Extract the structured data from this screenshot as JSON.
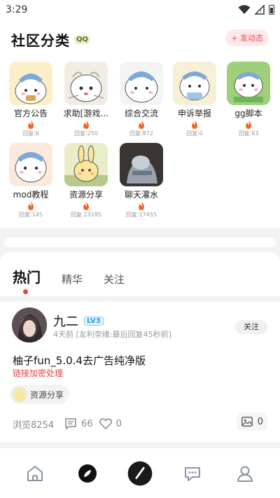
{
  "status_bar": {
    "time": "3:29"
  },
  "categories_section": {
    "title": "社区分类",
    "title_badge": "QQ",
    "post_button": "+ 发动态",
    "items": [
      {
        "name": "官方公告",
        "replies": "回复:6"
      },
      {
        "name": "求助[游戏…",
        "replies": "回复:250"
      },
      {
        "name": "综合交流",
        "replies": "回复:872"
      },
      {
        "name": "申诉举报",
        "replies": "回复:0"
      },
      {
        "name": "gg脚本",
        "replies": "回复:83"
      },
      {
        "name": "mod教程",
        "replies": "回复:145"
      },
      {
        "name": "资源分享",
        "replies": "回复:23185"
      },
      {
        "name": "聊天灌水",
        "replies": "回复:17455"
      }
    ]
  },
  "feed_tabs": [
    {
      "label": "热门",
      "active": true
    },
    {
      "label": "精华",
      "active": false
    },
    {
      "label": "关注",
      "active": false
    }
  ],
  "post": {
    "username": "九二",
    "level": "LV3",
    "meta": "4天前 [友利奈绪:最后回复45秒前]",
    "follow_label": "关注",
    "title": "柚子fun_5.0.4去广告纯净版",
    "subtitle": "链接加密处理",
    "tag": "资源分享",
    "views": "浏览8254",
    "comments": "66",
    "likes": "0",
    "images": "0"
  },
  "colors": {
    "accent_red": "#e8423f",
    "post_button_bg": "#fde8ea",
    "post_button_text": "#e84a5f"
  }
}
